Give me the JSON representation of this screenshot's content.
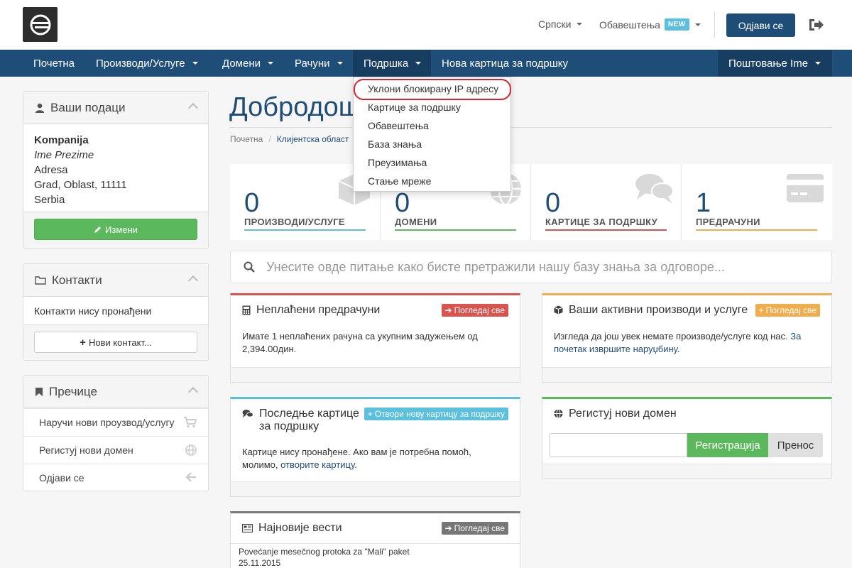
{
  "header": {
    "language": "Српски",
    "notifications": "Обавештења",
    "new_badge": "NEW",
    "logout_button": "Одјави се"
  },
  "nav": {
    "items": [
      {
        "label": "Почетна"
      },
      {
        "label": "Производи/Услуге"
      },
      {
        "label": "Домени"
      },
      {
        "label": "Рачуни"
      },
      {
        "label": "Подршка"
      },
      {
        "label": "Нова картица за подршку"
      }
    ],
    "account": "Поштовање Ime"
  },
  "support_menu": {
    "items": [
      "Уклони блокирану IP адресу",
      "Картице за подршку",
      "Обавештења",
      "База знања",
      "Преузимања",
      "Стање мреже"
    ],
    "highlighted_item": "Уклони блокирану IP адресу"
  },
  "sidebar": {
    "your_info": {
      "title": "Ваши подаци",
      "company": "Kompanija",
      "name": "Ime Prezime",
      "address": "Adresa",
      "city": "Grad, Oblast, 11111",
      "country": "Serbia",
      "edit_button": "Измени"
    },
    "contacts": {
      "title": "Контакти",
      "empty_text": "Контакти нису пронађени",
      "new_button": "Нови контакт..."
    },
    "shortcuts": {
      "title": "Пречице",
      "items": [
        "Наручи нови проузвод/услугу",
        "Регистуј нови домен",
        "Одјави се"
      ]
    }
  },
  "main": {
    "title": "Добродош",
    "breadcrumb": [
      "Почетна",
      "Клијентска област"
    ],
    "stats": [
      {
        "value": "0",
        "label": "ПРОИЗВОДИ/УСЛУГЕ",
        "color": "#5bc0de"
      },
      {
        "value": "0",
        "label": "ДОМЕНИ",
        "color": "#5cb85c"
      },
      {
        "value": "0",
        "label": "КАРТИЦЕ ЗА ПОДРШКУ",
        "color": "#d9534f"
      },
      {
        "value": "1",
        "label": "ПРЕДРАЧУНИ",
        "color": "#f0ad4e"
      }
    ],
    "search_placeholder": "Унесите овде питање како бисте претражили нашу базу знања за одговоре...",
    "unpaid": {
      "title": "Неплаћени предрачуни",
      "button": "Погледај све",
      "text": "Имате 1 неплаћених рачуна са укупним задужењем од 2,394.00дин."
    },
    "active_products": {
      "title": "Ваши активни производи и услуге",
      "button": "Погледај све",
      "text": "Изгледа да још увек немате производе/услуге код нас.",
      "link": "За почетак извршите наруџбину",
      "after": "."
    },
    "tickets": {
      "title": "Последње картице за подршку",
      "button": "Отвори нову картицу за подршку",
      "text": "Картице нису пронађене. Ако вам је потребна помоћ, молимо,",
      "link": "отворите картицу",
      "after": "."
    },
    "register_domain": {
      "title": "Регистуј нови домен",
      "register_button": "Регистрација",
      "transfer_button": "Пренос"
    },
    "news": {
      "title": "Најновије вести",
      "button": "Погледај све",
      "item_title": "Povećanje mesečnog protoka za \"Mali\" paket",
      "item_date": "25.11.2015"
    }
  }
}
